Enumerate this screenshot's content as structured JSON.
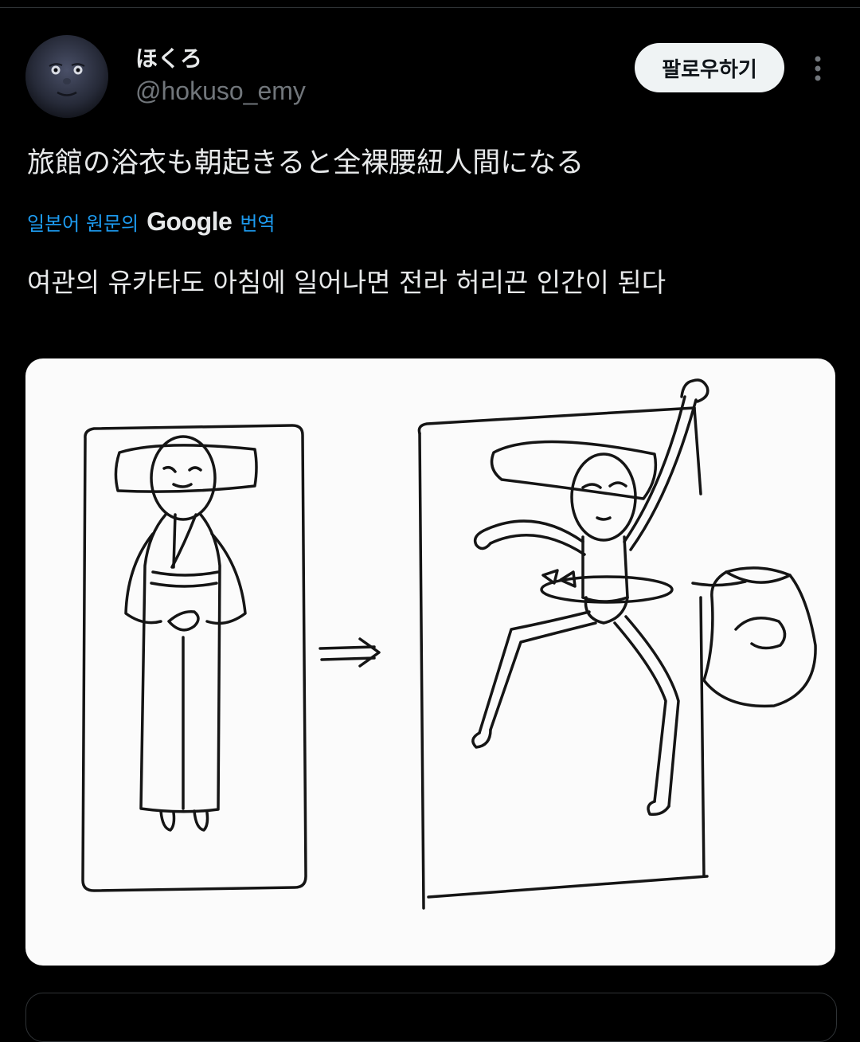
{
  "tweet": {
    "display_name": "ほくろ",
    "handle": "@hokuso_emy",
    "follow_label": "팔로우하기",
    "text": "旅館の浴衣も朝起きると全裸腰紐人間になる",
    "translate_prefix": "일본어 원문의",
    "translate_brand": "Google",
    "translate_suffix": "번역",
    "translated_text": "여관의 유카타도 아침에 일어나면 전라 허리끈 인간이 된다"
  },
  "icons": {
    "avatar": "full-moon-face-icon",
    "more": "more-vertical-icon"
  },
  "colors": {
    "background": "#000000",
    "text_primary": "#e7e9ea",
    "text_secondary": "#71767b",
    "link": "#1d9bf0",
    "follow_button_bg": "#eff3f4"
  }
}
